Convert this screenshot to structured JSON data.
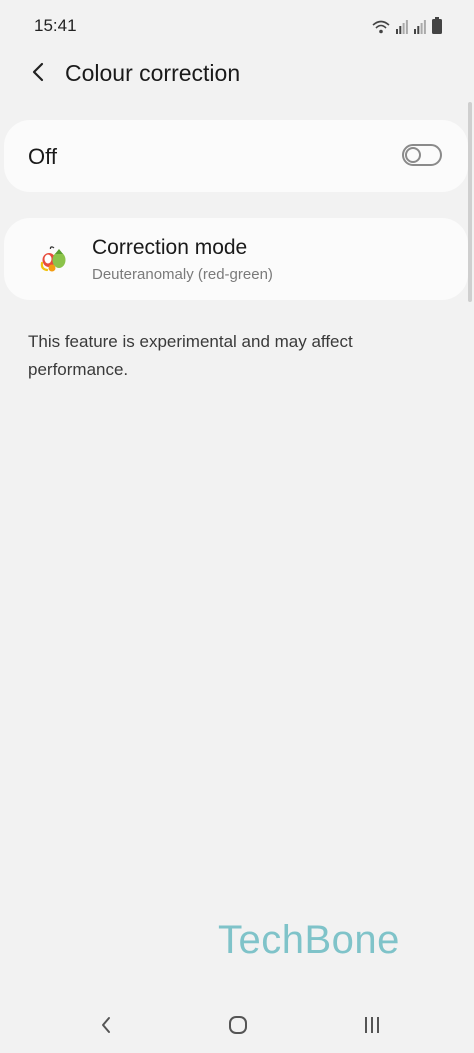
{
  "status_bar": {
    "time": "15:41",
    "icons": [
      "wifi-icon",
      "signal-icon",
      "signal-icon",
      "battery-icon"
    ]
  },
  "header": {
    "title": "Colour correction",
    "back_icon": "chevron-left-icon"
  },
  "toggle_card": {
    "label": "Off",
    "enabled": false
  },
  "mode_card": {
    "icon": "colour-correction-icon",
    "title": "Correction mode",
    "subtitle": "Deuteranomaly (red-green)"
  },
  "info": {
    "text": "This feature is experimental and may affect performance."
  },
  "watermark": {
    "text": "TechBone",
    "color": "#7fc3c9"
  },
  "nav_bar": {
    "items": [
      "back-icon",
      "home-icon",
      "recents-icon"
    ]
  }
}
